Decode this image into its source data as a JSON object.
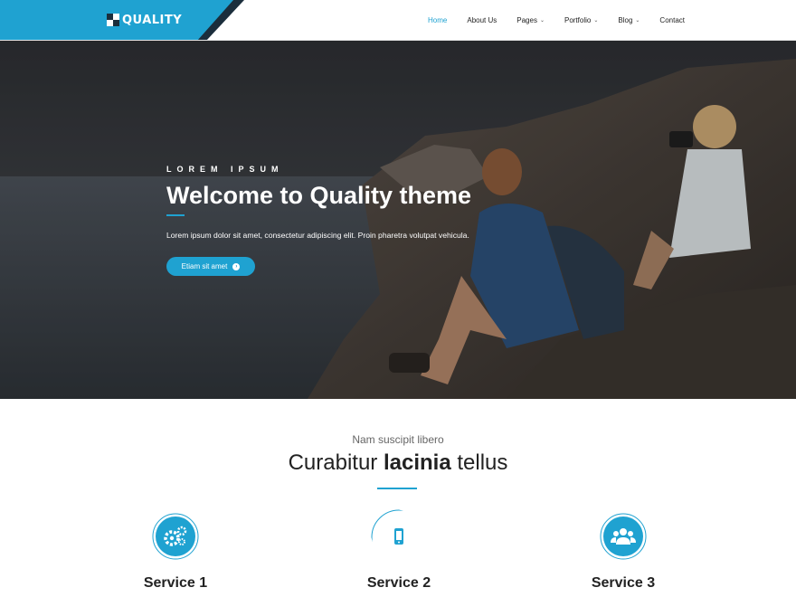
{
  "header": {
    "logo_text": "QUALITY",
    "nav": [
      {
        "label": "Home",
        "active": true,
        "dropdown": false
      },
      {
        "label": "About Us",
        "active": false,
        "dropdown": false
      },
      {
        "label": "Pages",
        "active": false,
        "dropdown": true
      },
      {
        "label": "Portfolio",
        "active": false,
        "dropdown": true
      },
      {
        "label": "Blog",
        "active": false,
        "dropdown": true
      },
      {
        "label": "Contact",
        "active": false,
        "dropdown": false
      }
    ]
  },
  "hero": {
    "kicker": "LOREM IPSUM",
    "title": "Welcome to Quality theme",
    "text": "Lorem ipsum dolor sit amet, consectetur adipiscing elit. Proin pharetra volutpat vehicula.",
    "button_label": "Etiam sit amet",
    "button_icon": "chevron-right-circle-icon"
  },
  "services_section": {
    "subheading": "Nam suscipit libero",
    "heading_pre": "Curabitur ",
    "heading_bold": "lacinia",
    "heading_post": " tellus",
    "services": [
      {
        "title": "Service 1",
        "icon": "gears-icon"
      },
      {
        "title": "Service 2",
        "icon": "mobile-icon"
      },
      {
        "title": "Service 3",
        "icon": "users-icon"
      }
    ]
  },
  "colors": {
    "accent": "#1fa2d1",
    "dark": "#222222"
  }
}
